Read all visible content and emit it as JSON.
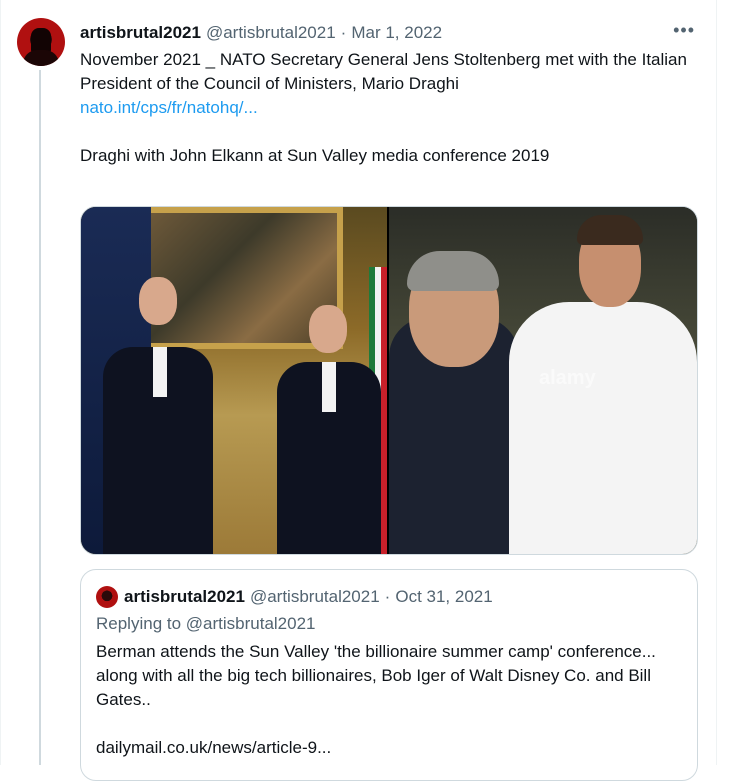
{
  "tweet": {
    "display_name": "artisbrutal2021",
    "handle": "@artisbrutal2021",
    "separator": "·",
    "date": "Mar 1, 2022",
    "more_icon": "more-horizontal-icon",
    "more_glyph": "•••",
    "text_line1": "November 2021 _  NATO Secretary General Jens Stoltenberg met with the Italian President of the Council of Ministers, Mario Draghi",
    "link": "nato.int/cps/fr/natohq/...",
    "text_line2": "Draghi with John Elkann at Sun Valley media conference 2019",
    "media_watermark": "alamy"
  },
  "quoted_tweet": {
    "display_name": "artisbrutal2021",
    "handle": "@artisbrutal2021",
    "separator": "·",
    "date": "Oct 31, 2021",
    "replying_to": "Replying to @artisbrutal2021",
    "text": "Berman attends the Sun Valley 'the billionaire summer camp' conference... along with all the big tech billionaires, Bob Iger of Walt Disney Co. and Bill Gates..",
    "link": "dailymail.co.uk/news/article-9..."
  },
  "colors": {
    "link": "#1d9bf0",
    "secondary_text": "#536471",
    "border": "#cfd9de"
  }
}
